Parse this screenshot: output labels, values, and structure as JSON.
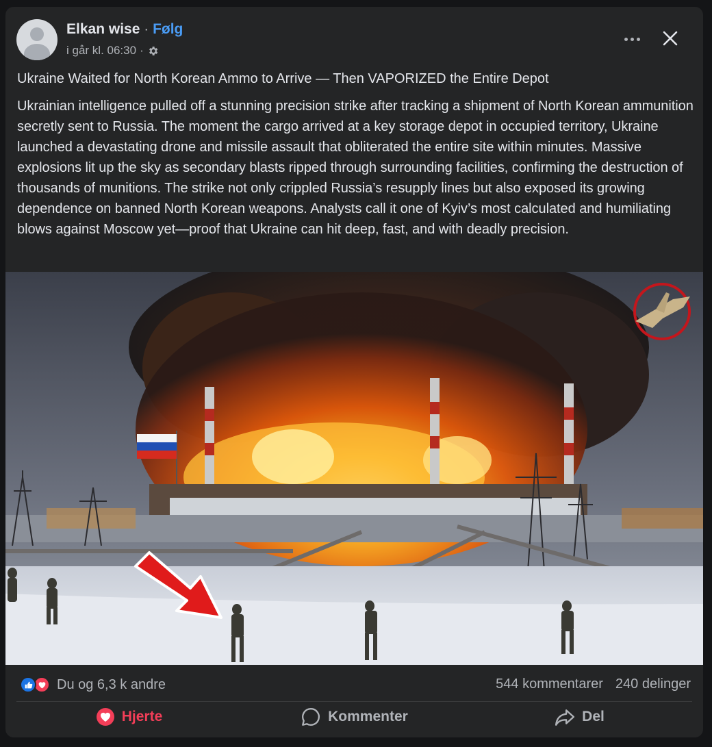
{
  "post": {
    "author": "Elkan wise",
    "separator": " · ",
    "follow_label": "Følg",
    "timestamp": "i går kl. 06:30",
    "meta_separator": "·",
    "title": "Ukraine Waited for North Korean Ammo to Arrive — Then VAPORIZED the Entire Depot",
    "body": "Ukrainian intelligence pulled off a stunning precision strike after tracking a shipment of North Korean ammunition secretly sent to Russia. The moment the cargo arrived at a key storage depot in occupied territory, Ukraine launched a devastating drone and missile assault that obliterated the entire site within minutes. Massive explosions lit up the sky as secondary blasts ripped through surrounding facilities, confirming the destruction of thousands of munitions. The strike not only crippled Russia’s resupply lines but also exposed its growing dependence on banned North Korean weapons. Analysts call it one of Kyiv’s most calculated and humiliating blows against Moscow yet—proof that Ukraine can hit deep, fast, and with deadly precision."
  },
  "stats": {
    "reactions_text": "Du og 6,3 k andre",
    "comments": "544 kommentarer",
    "shares": "240 delinger"
  },
  "actions": {
    "heart_label": "Hjerte",
    "comment_label": "Kommenter",
    "share_label": "Del"
  },
  "icons": {
    "avatar": "default-avatar-icon",
    "privacy": "gear-icon",
    "more": "more-dots-icon",
    "close": "close-icon",
    "like": "like-icon",
    "heart": "heart-icon",
    "comment": "comment-icon",
    "share": "share-icon",
    "watermark": "fighter-jet-logo"
  },
  "colors": {
    "card": "#242526",
    "background": "#141517",
    "link": "#4a9cf5",
    "heart": "#f33e58",
    "like": "#1b74e4",
    "muted": "#b0b3b8"
  }
}
